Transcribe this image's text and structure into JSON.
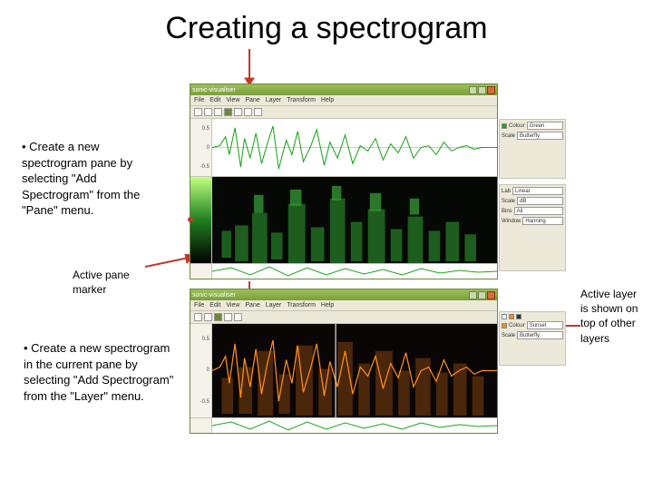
{
  "title": "Creating a spectrogram",
  "bullet1": "• Create a new spectrogram pane by selecting \"Add Spectrogram\" from the \"Pane\" menu.",
  "label_marker": "Active pane\nmarker",
  "bullet2": "• Create a new spectrogram in the current pane by selecting \"Add Spectrogram\" from the \"Layer\" menu.",
  "label_active_layer": "Active layer is shown on top of other layers",
  "window1": {
    "title": "sonic-visualiser",
    "menus": [
      "File",
      "Edit",
      "View",
      "Pane",
      "Layer",
      "Transform",
      "Help"
    ],
    "side": {
      "colour": "Colour",
      "scale": "Scale",
      "value_green": "Green",
      "value_butterfly": "Butterfly",
      "lab": "Lab",
      "scale2": "Scale",
      "bins": "Bins",
      "window": "Window",
      "value1": "Linear",
      "value2": "dB",
      "value3": "All",
      "value4": "Linear",
      "value5": "Hanning"
    }
  },
  "window2": {
    "title": "sonic-visualiser",
    "menus": [
      "File",
      "Edit",
      "View",
      "Pane",
      "Layer",
      "Transform",
      "Help"
    ],
    "side": {
      "colour": "Colour",
      "scale": "Scale",
      "value_orange": "Sunset",
      "value_butterfly": "Butterfly"
    }
  }
}
